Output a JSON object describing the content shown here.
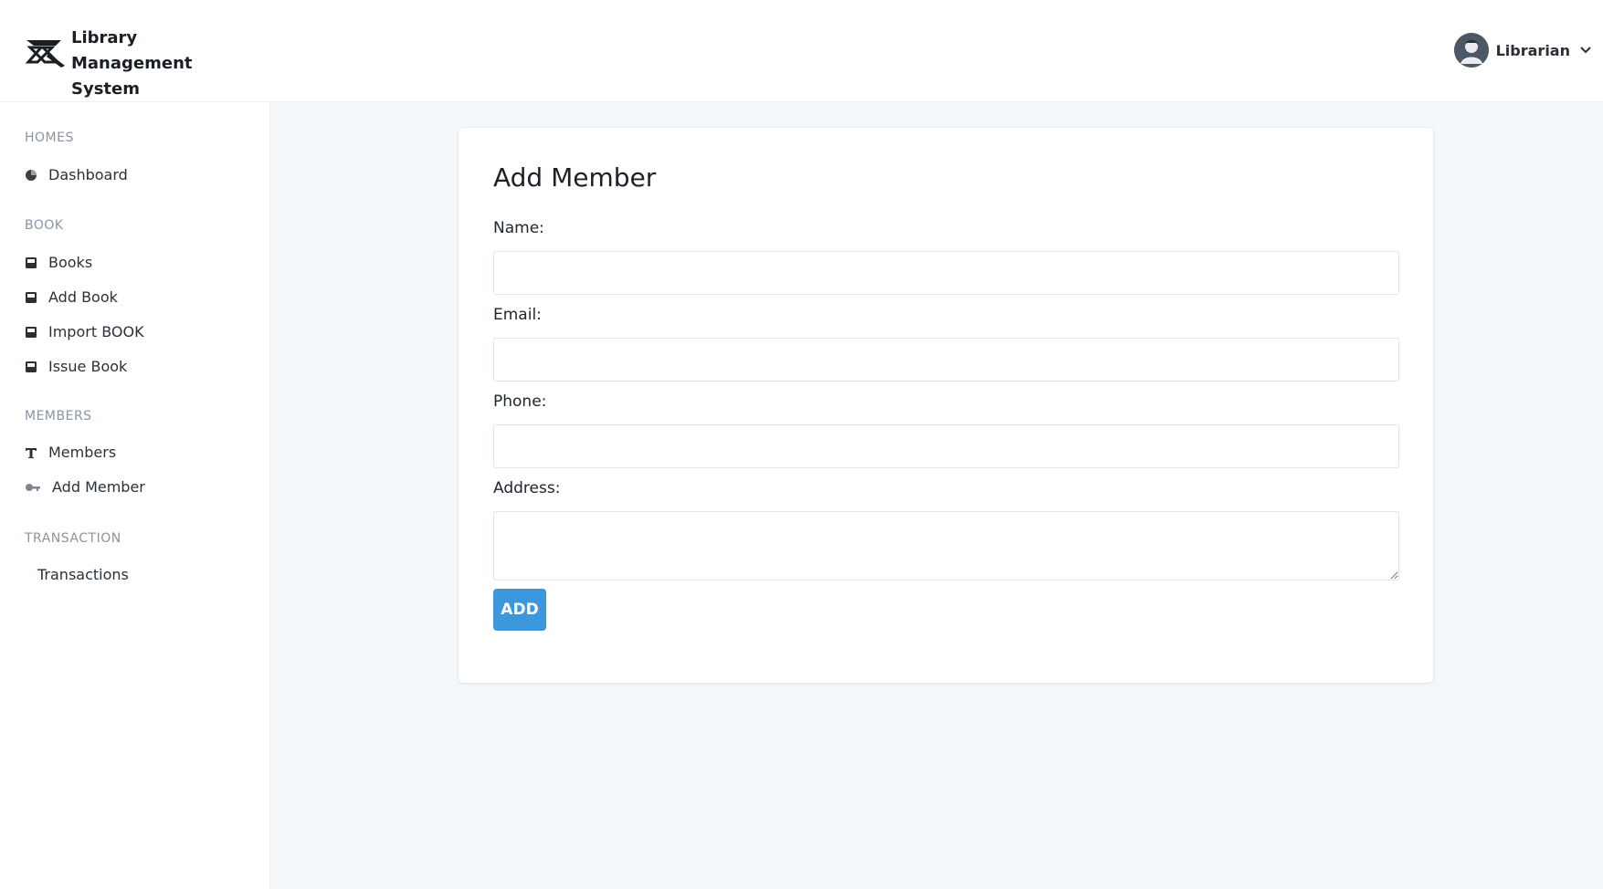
{
  "app": {
    "title": "Library Management System",
    "title_line1": "Library Management",
    "title_line2": "System"
  },
  "user": {
    "name": "Librarian"
  },
  "sidebar": {
    "sections": [
      {
        "label": "HOMES",
        "items": [
          {
            "label": "Dashboard",
            "icon": "pie-chart-icon"
          }
        ]
      },
      {
        "label": "BOOK",
        "items": [
          {
            "label": "Books",
            "icon": "book-icon"
          },
          {
            "label": "Add Book",
            "icon": "book-icon"
          },
          {
            "label": "Import BOOK",
            "icon": "book-icon"
          },
          {
            "label": "Issue Book",
            "icon": "book-icon"
          }
        ]
      },
      {
        "label": "MEMBERS",
        "items": [
          {
            "label": "Members",
            "icon": "text-t-icon"
          },
          {
            "label": "Add Member",
            "icon": "key-icon"
          }
        ]
      },
      {
        "label": "TRANSACTION",
        "items": [
          {
            "label": "Transactions",
            "icon": ""
          }
        ]
      }
    ]
  },
  "form": {
    "title": "Add Member",
    "fields": [
      {
        "label": "Name:",
        "value": "",
        "placeholder": ""
      },
      {
        "label": "Email:",
        "value": "",
        "placeholder": ""
      },
      {
        "label": "Phone:",
        "value": "",
        "placeholder": ""
      },
      {
        "label": "Address:",
        "value": "",
        "placeholder": ""
      }
    ],
    "submit_label": "ADD"
  },
  "colors": {
    "accent": "#3d97dd",
    "background": "#f5f8fb",
    "section_label": "#8a94a3"
  }
}
